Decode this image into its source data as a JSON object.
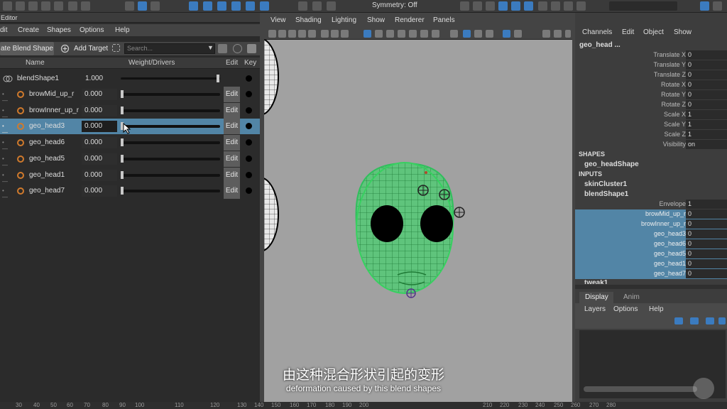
{
  "topbar": {
    "symmetry": "Symmetry: Off"
  },
  "editor": {
    "title": "Editor",
    "menu": [
      "dit",
      "Create",
      "Shapes",
      "Options",
      "Help"
    ],
    "create_blend": "ate Blend Shape",
    "add_target": "Add Target",
    "search_placeholder": "Search...",
    "columns": {
      "name": "Name",
      "weight": "Weight/Drivers",
      "edit": "Edit",
      "key": "Key"
    },
    "blendshape_name": "blendShape1",
    "blendshape_value": "1.000",
    "targets": [
      {
        "name": "browMid_up_r",
        "value": "0.000",
        "edit": "Edit"
      },
      {
        "name": "browInner_up_r",
        "value": "0.000",
        "edit": "Edit"
      },
      {
        "name": "geo_head3",
        "value": "0.000",
        "edit": "Edit"
      },
      {
        "name": "geo_head6",
        "value": "0.000",
        "edit": "Edit"
      },
      {
        "name": "geo_head5",
        "value": "0.000",
        "edit": "Edit"
      },
      {
        "name": "geo_head1",
        "value": "0.000",
        "edit": "Edit"
      },
      {
        "name": "geo_head7",
        "value": "0.000",
        "edit": "Edit"
      }
    ]
  },
  "viewport": {
    "menu": [
      "View",
      "Shading",
      "Lighting",
      "Show",
      "Renderer",
      "Panels"
    ]
  },
  "channelbox": {
    "menu": [
      "Channels",
      "Edit",
      "Object",
      "Show"
    ],
    "object": "geo_head ...",
    "attrs": [
      {
        "name": "Translate X",
        "value": "0"
      },
      {
        "name": "Translate Y",
        "value": "0"
      },
      {
        "name": "Translate Z",
        "value": "0"
      },
      {
        "name": "Rotate X",
        "value": "0"
      },
      {
        "name": "Rotate Y",
        "value": "0"
      },
      {
        "name": "Rotate Z",
        "value": "0"
      },
      {
        "name": "Scale X",
        "value": "1"
      },
      {
        "name": "Scale Y",
        "value": "1"
      },
      {
        "name": "Scale Z",
        "value": "1"
      },
      {
        "name": "Visibility",
        "value": "on"
      }
    ],
    "shapes_header": "SHAPES",
    "shape": "geo_headShape",
    "inputs_header": "INPUTS",
    "inputs": [
      "skinCluster1",
      "blendShape1"
    ],
    "envelope": {
      "name": "Envelope",
      "value": "1"
    },
    "bs_attrs": [
      {
        "name": "browMid_up_r",
        "value": "0"
      },
      {
        "name": "browInner_up_r",
        "value": "0"
      },
      {
        "name": "geo_head3",
        "value": "0"
      },
      {
        "name": "geo_head6",
        "value": "0"
      },
      {
        "name": "geo_head5",
        "value": "0"
      },
      {
        "name": "geo_head1",
        "value": "0"
      },
      {
        "name": "geo_head7",
        "value": "0"
      }
    ],
    "tweak": "tweak1",
    "tabs": [
      "Display",
      "Anim"
    ],
    "layer_menu": [
      "Layers",
      "Options",
      "Help"
    ]
  },
  "subtitles": {
    "cn": "由这种混合形状引起的变形",
    "en": "deformation caused by this blend shapes"
  },
  "timeline": [
    "30",
    "40",
    "50",
    "60",
    "70",
    "80",
    "90",
    "100",
    "110",
    "120",
    "130",
    "140",
    "150",
    "160",
    "170",
    "180",
    "190",
    "200",
    "210",
    "220",
    "230",
    "240",
    "250",
    "260",
    "270",
    "280"
  ]
}
